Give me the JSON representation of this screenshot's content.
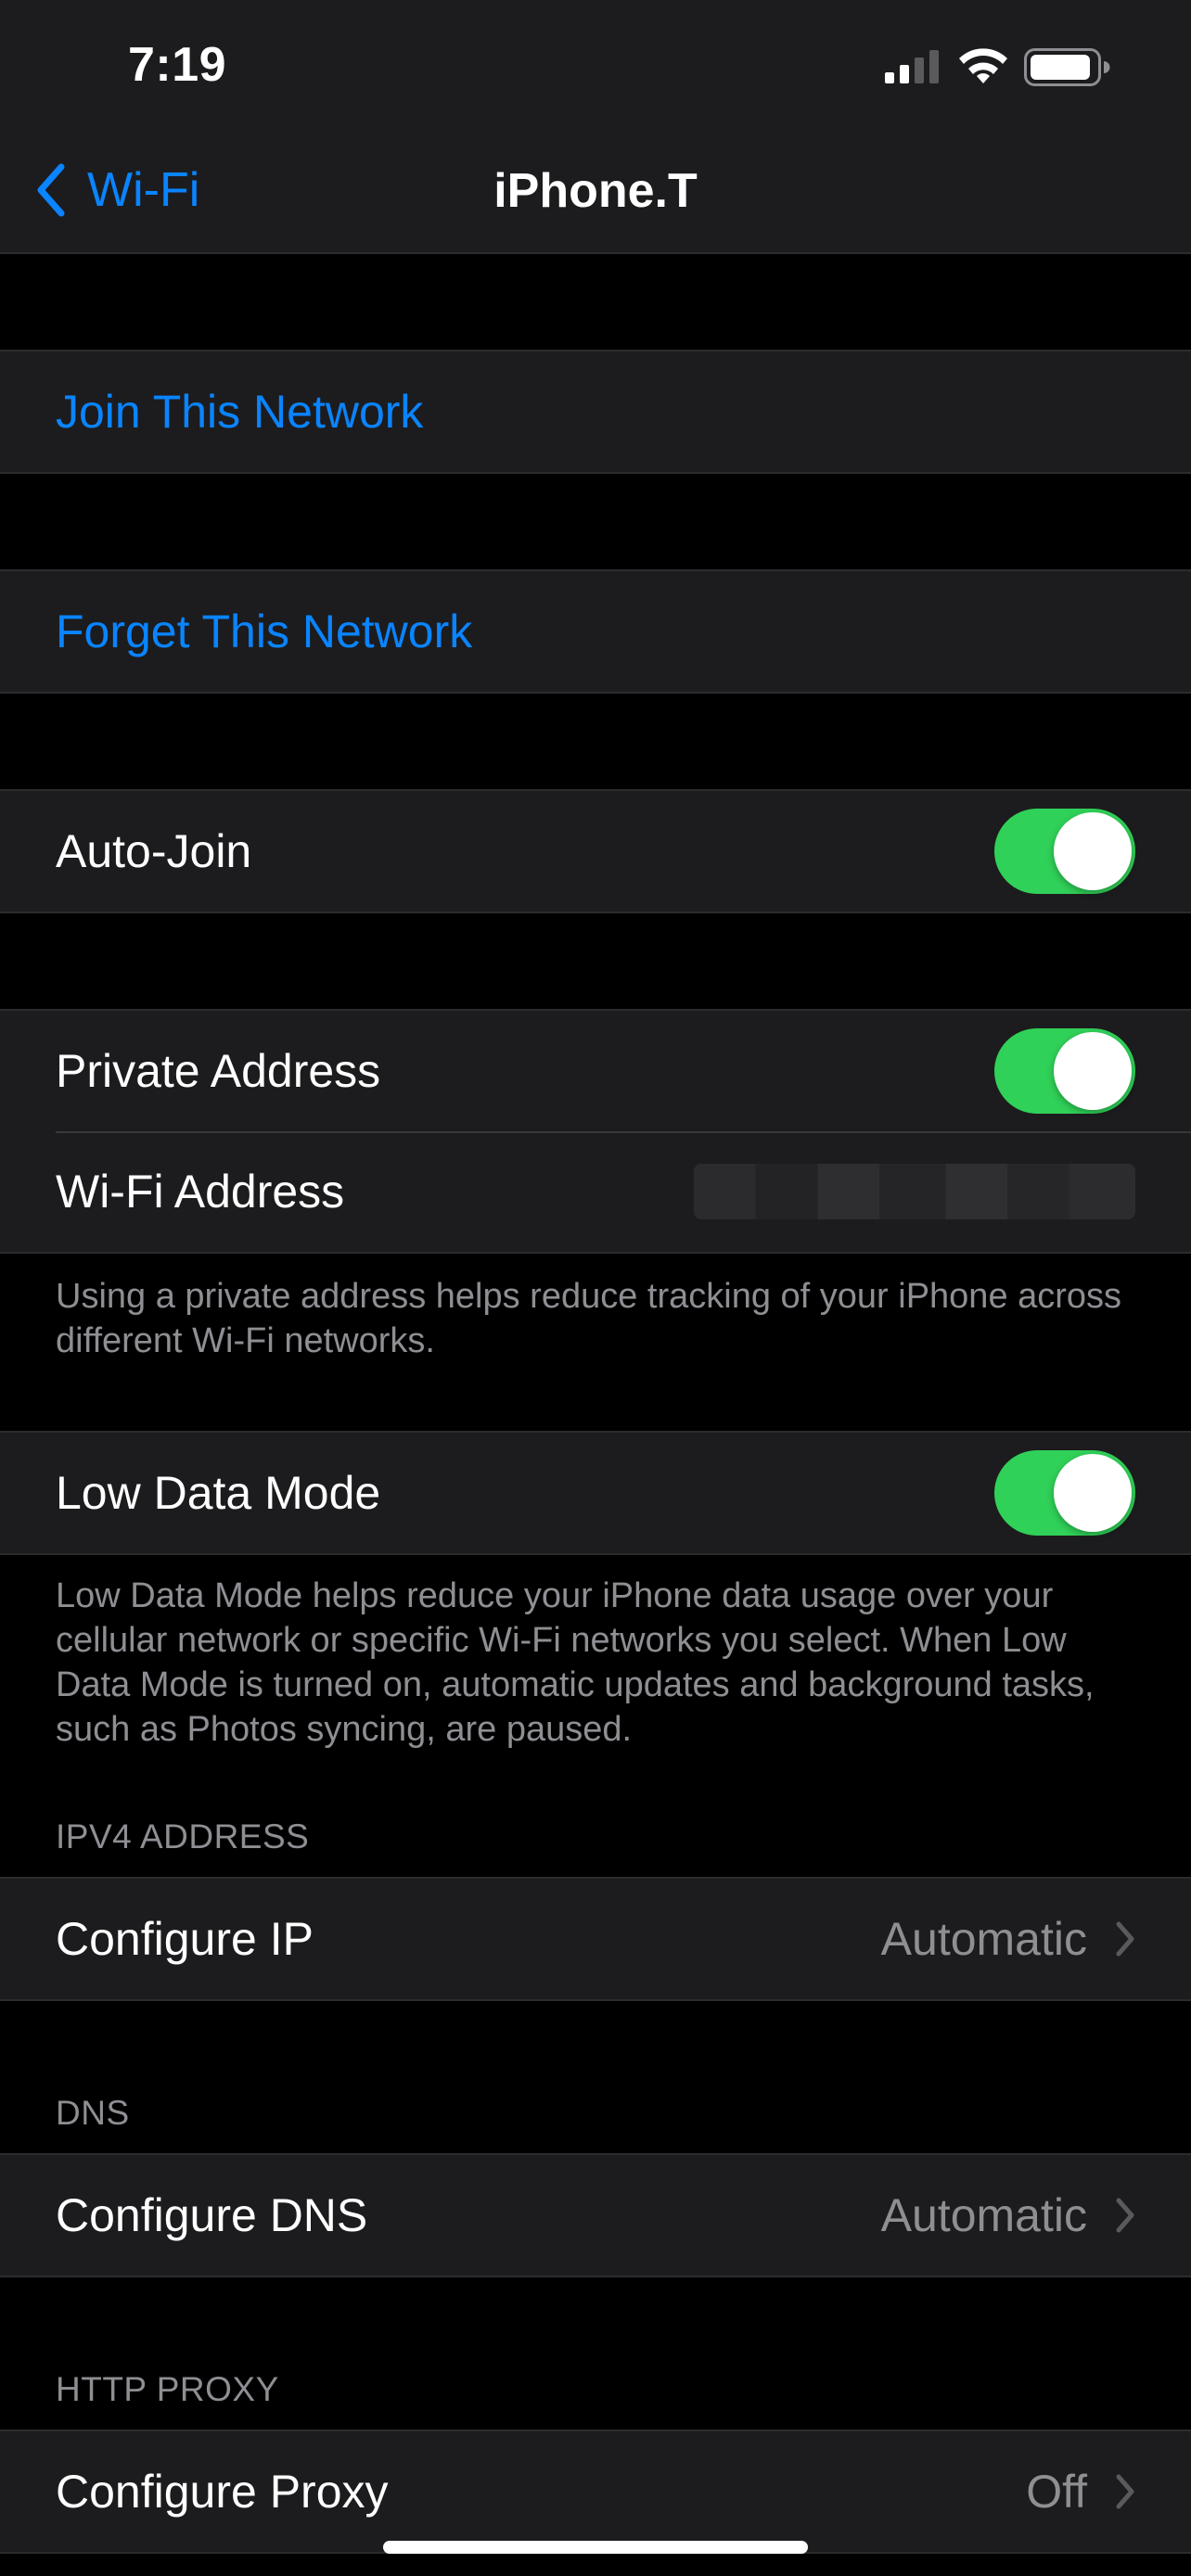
{
  "status_bar": {
    "time": "7:19"
  },
  "nav": {
    "back_label": "Wi-Fi",
    "title": "iPhone.T"
  },
  "join": {
    "label": "Join This Network"
  },
  "forget": {
    "label": "Forget This Network"
  },
  "auto_join": {
    "label": "Auto-Join",
    "on": true
  },
  "private_address": {
    "label": "Private Address",
    "on": true,
    "wifi_address_label": "Wi-Fi Address",
    "footer": "Using a private address helps reduce tracking of your iPhone across different Wi-Fi networks."
  },
  "low_data_mode": {
    "label": "Low Data Mode",
    "on": true,
    "footer": "Low Data Mode helps reduce your iPhone data usage over your cellular network or specific Wi-Fi networks you select. When Low Data Mode is turned on, automatic updates and background tasks, such as Photos syncing, are paused."
  },
  "ipv4": {
    "header": "IPV4 ADDRESS",
    "label": "Configure IP",
    "value": "Automatic"
  },
  "dns": {
    "header": "DNS",
    "label": "Configure DNS",
    "value": "Automatic"
  },
  "proxy": {
    "header": "HTTP PROXY",
    "label": "Configure Proxy",
    "value": "Off"
  },
  "colors": {
    "accent": "#0a84ff",
    "toggle_on": "#30d158",
    "cell_bg": "#1c1c1e",
    "secondary_text": "#8e8e93"
  }
}
